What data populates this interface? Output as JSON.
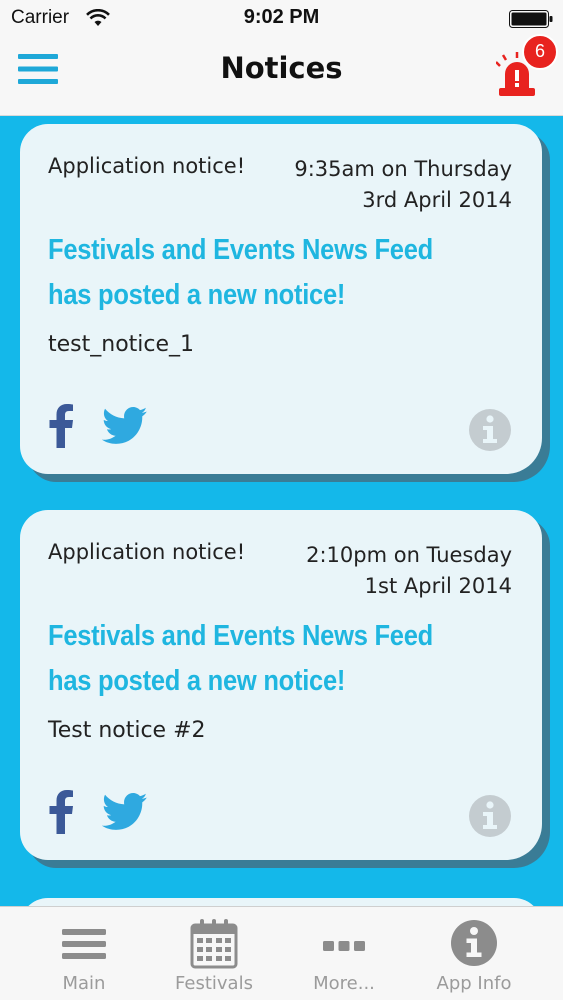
{
  "status_bar": {
    "carrier": "Carrier",
    "time": "9:02 PM"
  },
  "nav": {
    "title": "Notices",
    "menu_icon": "hamburger-menu-icon",
    "alarm_icon": "siren-alarm-icon",
    "badge_count": "6"
  },
  "colors": {
    "background": "#14b8ea",
    "card": "#e9f5f9",
    "headline": "#1fb6e0",
    "badge": "#e8231f",
    "facebook": "#3b5998",
    "twitter": "#2fa9e0"
  },
  "notices": [
    {
      "source": "Application notice!",
      "time": "9:35am on Thursday",
      "date": "3rd April 2014",
      "headline": "Festivals and Events News Feed has posted a new notice!",
      "body": "test_notice_1"
    },
    {
      "source": "Application notice!",
      "time": "2:10pm on Tuesday",
      "date": "1st April 2014",
      "headline": "Festivals and Events News Feed has posted a new notice!",
      "body": "Test notice #2"
    }
  ],
  "tabs": [
    {
      "label": "Main",
      "icon": "list-icon"
    },
    {
      "label": "Festivals",
      "icon": "calendar-icon"
    },
    {
      "label": "More...",
      "icon": "more-dots-icon"
    },
    {
      "label": "App Info",
      "icon": "info-icon"
    }
  ]
}
